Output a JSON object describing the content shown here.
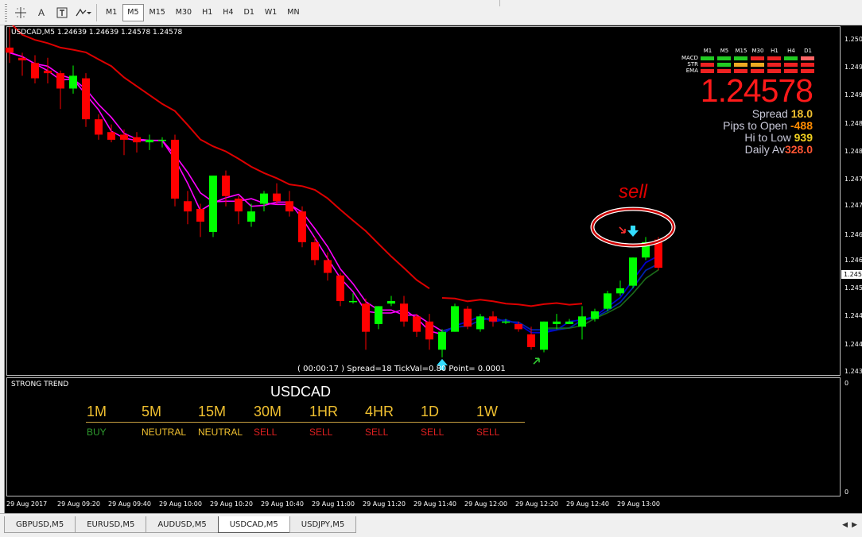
{
  "toolbar": {
    "icons": [
      "crosshair-icon",
      "text-icon",
      "text-label-icon",
      "shapes-icon"
    ],
    "text_tool": "A",
    "timeframes": [
      "M1",
      "M5",
      "M15",
      "M30",
      "H1",
      "H4",
      "D1",
      "W1",
      "MN"
    ],
    "active_timeframe": "M5"
  },
  "chart": {
    "header": "USDCAD,M5  1.24639 1.24639 1.24578 1.24578",
    "status_line": "( 00:00:17 )  Spread=18  TickVal=0.80  Point= 0.0001",
    "price_ticks": [
      "1.2503",
      "1.2498",
      "1.2492",
      "1.2487",
      "1.2481",
      "1.2476",
      "1.2471",
      "1.2465",
      "1.2460",
      "1.2455",
      "1.2449",
      "1.2444",
      "1.2438"
    ],
    "current_price_tag": "1.2457",
    "sub_ticks": [
      "0",
      "0"
    ],
    "time_ticks": [
      "29 Aug 2017",
      "29 Aug 09:20",
      "29 Aug 09:40",
      "29 Aug 10:00",
      "29 Aug 10:20",
      "29 Aug 10:40",
      "29 Aug 11:00",
      "29 Aug 11:20",
      "29 Aug 11:40",
      "29 Aug 12:00",
      "29 Aug 12:20",
      "29 Aug 12:40",
      "29 Aug 13:00"
    ],
    "annotation": "sell",
    "colors": {
      "bull": "#00ff00",
      "bear": "#ff0000",
      "ema_red": "#dd0000",
      "ma_magenta": "#ff00ff",
      "ma_blue": "#0000cc",
      "arrow": "#33ddff"
    }
  },
  "dashboard": {
    "tf_headers": [
      "M1",
      "M5",
      "M15",
      "M30",
      "H1",
      "H4",
      "D1"
    ],
    "rows": [
      {
        "name": "MACD",
        "colors": [
          "#22cc22",
          "#22cc22",
          "#22cc22",
          "#ee2222",
          "#ee2222",
          "#22cc22",
          "#ff6666"
        ]
      },
      {
        "name": "STR",
        "colors": [
          "#ee2222",
          "#22cc22",
          "#eeaa22",
          "#eeaa22",
          "#ee2222",
          "#ee2222",
          "#ee2222"
        ]
      },
      {
        "name": "EMA",
        "colors": [
          "#ee2222",
          "#ee2222",
          "#ee2222",
          "#ee2222",
          "#ee2222",
          "#ee2222",
          "#ee2222"
        ]
      }
    ],
    "price": "1.24578",
    "spread_label": "Spread",
    "spread_value": "18.0",
    "pips_label": "Pips to Open",
    "pips_value": "-488",
    "hilo_label": "Hi to Low",
    "hilo_value": "939",
    "daily_label": "Daily Av",
    "daily_value": "328.0",
    "value_colors": {
      "spread": "#f0c030",
      "pips": "#ff8c00",
      "hilo": "#f0d020",
      "daily": "#ff5533"
    }
  },
  "strong_trend": {
    "label": "STRONG TREND",
    "symbol": "USDCAD",
    "timeframes": [
      "1M",
      "5M",
      "15M",
      "30M",
      "1HR",
      "4HR",
      "1D",
      "1W"
    ],
    "signals": [
      "BUY",
      "NEUTRAL",
      "NEUTRAL",
      "SELL",
      "SELL",
      "SELL",
      "SELL",
      "SELL"
    ],
    "signal_colors": {
      "BUY": "#2e9a2e",
      "NEUTRAL": "#f0c030",
      "SELL": "#e02020"
    }
  },
  "tabs": [
    "GBPUSD,M5",
    "EURUSD,M5",
    "AUDUSD,M5",
    "USDCAD,M5",
    "USDJPY,M5"
  ],
  "active_tab": "USDCAD,M5",
  "candles": [
    {
      "o": 1.2501,
      "h": 1.2505,
      "l": 1.2498,
      "c": 1.25
    },
    {
      "o": 1.2499,
      "h": 1.25,
      "l": 1.24955,
      "c": 1.24985
    },
    {
      "o": 1.2498,
      "h": 1.24995,
      "l": 1.2494,
      "c": 1.2495
    },
    {
      "o": 1.24965,
      "h": 1.2499,
      "l": 1.2494,
      "c": 1.2496
    },
    {
      "o": 1.2496,
      "h": 1.24965,
      "l": 1.2489,
      "c": 1.2493
    },
    {
      "o": 1.2493,
      "h": 1.24975,
      "l": 1.2492,
      "c": 1.24955
    },
    {
      "o": 1.2495,
      "h": 1.2496,
      "l": 1.24855,
      "c": 1.2487
    },
    {
      "o": 1.2487,
      "h": 1.2488,
      "l": 1.2483,
      "c": 1.2484
    },
    {
      "o": 1.24845,
      "h": 1.2486,
      "l": 1.24825,
      "c": 1.2483
    },
    {
      "o": 1.2484,
      "h": 1.2485,
      "l": 1.248,
      "c": 1.2483
    },
    {
      "o": 1.24835,
      "h": 1.24845,
      "l": 1.24805,
      "c": 1.24825
    },
    {
      "o": 1.24825,
      "h": 1.2484,
      "l": 1.2481,
      "c": 1.2483
    },
    {
      "o": 1.2483,
      "h": 1.24835,
      "l": 1.24815,
      "c": 1.2483
    },
    {
      "o": 1.2483,
      "h": 1.2484,
      "l": 1.247,
      "c": 1.24715
    },
    {
      "o": 1.2471,
      "h": 1.2473,
      "l": 1.24665,
      "c": 1.2469
    },
    {
      "o": 1.24695,
      "h": 1.24705,
      "l": 1.2464,
      "c": 1.2467
    },
    {
      "o": 1.2465,
      "h": 1.2476,
      "l": 1.2464,
      "c": 1.2476
    },
    {
      "o": 1.2476,
      "h": 1.2477,
      "l": 1.247,
      "c": 1.2472
    },
    {
      "o": 1.24715,
      "h": 1.2472,
      "l": 1.24665,
      "c": 1.2469
    },
    {
      "o": 1.2467,
      "h": 1.24705,
      "l": 1.2466,
      "c": 1.2469
    },
    {
      "o": 1.24705,
      "h": 1.2473,
      "l": 1.2469,
      "c": 1.24725
    },
    {
      "o": 1.24725,
      "h": 1.24745,
      "l": 1.24705,
      "c": 1.2471
    },
    {
      "o": 1.2471,
      "h": 1.2473,
      "l": 1.2468,
      "c": 1.2469
    },
    {
      "o": 1.2469,
      "h": 1.247,
      "l": 1.2462,
      "c": 1.2463
    },
    {
      "o": 1.2463,
      "h": 1.2464,
      "l": 1.24585,
      "c": 1.24595
    },
    {
      "o": 1.24595,
      "h": 1.2461,
      "l": 1.24555,
      "c": 1.2457
    },
    {
      "o": 1.24565,
      "h": 1.2457,
      "l": 1.24505,
      "c": 1.24515
    },
    {
      "o": 1.24515,
      "h": 1.2453,
      "l": 1.2451,
      "c": 1.24515
    },
    {
      "o": 1.2451,
      "h": 1.2452,
      "l": 1.2442,
      "c": 1.24455
    },
    {
      "o": 1.2447,
      "h": 1.24505,
      "l": 1.2446,
      "c": 1.24505
    },
    {
      "o": 1.2451,
      "h": 1.24525,
      "l": 1.24505,
      "c": 1.24515
    },
    {
      "o": 1.2451,
      "h": 1.24525,
      "l": 1.24465,
      "c": 1.24475
    },
    {
      "o": 1.24485,
      "h": 1.2449,
      "l": 1.24445,
      "c": 1.24455
    },
    {
      "o": 1.24475,
      "h": 1.2449,
      "l": 1.2442,
      "c": 1.2444
    },
    {
      "o": 1.2442,
      "h": 1.2446,
      "l": 1.24405,
      "c": 1.24455
    },
    {
      "o": 1.24455,
      "h": 1.2451,
      "l": 1.24455,
      "c": 1.24505
    },
    {
      "o": 1.245,
      "h": 1.24505,
      "l": 1.2446,
      "c": 1.24465
    },
    {
      "o": 1.2446,
      "h": 1.2449,
      "l": 1.24455,
      "c": 1.24485
    },
    {
      "o": 1.24485,
      "h": 1.24495,
      "l": 1.24465,
      "c": 1.24475
    },
    {
      "o": 1.24475,
      "h": 1.2448,
      "l": 1.2447,
      "c": 1.24475
    },
    {
      "o": 1.2447,
      "h": 1.24475,
      "l": 1.24455,
      "c": 1.2446
    },
    {
      "o": 1.2445,
      "h": 1.24465,
      "l": 1.2442,
      "c": 1.24425
    },
    {
      "o": 1.2442,
      "h": 1.24475,
      "l": 1.24415,
      "c": 1.24475
    },
    {
      "o": 1.2447,
      "h": 1.2449,
      "l": 1.2446,
      "c": 1.24475
    },
    {
      "o": 1.2447,
      "h": 1.2448,
      "l": 1.2447,
      "c": 1.24475
    },
    {
      "o": 1.24465,
      "h": 1.24505,
      "l": 1.2444,
      "c": 1.24485
    },
    {
      "o": 1.2448,
      "h": 1.245,
      "l": 1.24475,
      "c": 1.24495
    },
    {
      "o": 1.245,
      "h": 1.24535,
      "l": 1.24495,
      "c": 1.2453
    },
    {
      "o": 1.2453,
      "h": 1.24555,
      "l": 1.24525,
      "c": 1.2454
    },
    {
      "o": 1.24545,
      "h": 1.246,
      "l": 1.2454,
      "c": 1.246
    },
    {
      "o": 1.246,
      "h": 1.2464,
      "l": 1.24595,
      "c": 1.2463
    },
    {
      "o": 1.24635,
      "h": 1.2464,
      "l": 1.24575,
      "c": 1.2458
    }
  ]
}
